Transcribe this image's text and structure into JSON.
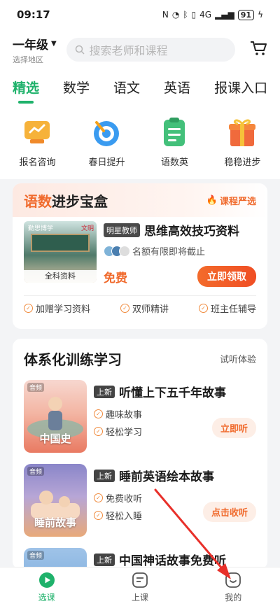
{
  "status": {
    "time": "09:17",
    "signal": "4G",
    "battery": "91"
  },
  "header": {
    "grade": "一年级",
    "region": "选择地区",
    "search_placeholder": "搜索老师和课程"
  },
  "tabs": [
    "精选",
    "数学",
    "语文",
    "英语",
    "报课入口"
  ],
  "quick": [
    {
      "label": "报名咨询",
      "color": "#f6b23a"
    },
    {
      "label": "春日提升",
      "color": "#3a9bf0"
    },
    {
      "label": "语数英",
      "color": "#43c07a"
    },
    {
      "label": "稳稳进步",
      "color": "#f06a3c"
    }
  ],
  "card1": {
    "title_hl": "语数",
    "title_rest": "进步宝盒",
    "strict": "课程严选",
    "thumb_tag": "勤思博学",
    "thumb_tag2": "文明",
    "thumb_caption": "全科资料",
    "teacher_badge": "明星教师",
    "name": "思维高效技巧资料",
    "quota": "名额有限即将截止",
    "price": "免费",
    "cta": "立即领取",
    "perks": [
      "加赠学习资料",
      "双师精讲",
      "班主任辅导"
    ]
  },
  "card2": {
    "title": "体系化训练学习",
    "trial": "试听体验",
    "courses": [
      {
        "new": "上新",
        "title": "听懂上下五千年故事",
        "tag": "音频",
        "thumb_label": "中国史",
        "features": [
          "趣味故事",
          "轻松学习"
        ],
        "cta": "立即听"
      },
      {
        "new": "上新",
        "title": "睡前英语绘本故事",
        "tag": "音频",
        "thumb_label": "睡前故事",
        "features": [
          "免费收听",
          "轻松入睡"
        ],
        "cta": "点击收听"
      },
      {
        "new": "上新",
        "title": "中国神话故事免费听",
        "tag": "音频",
        "thumb_label": "",
        "features": [],
        "cta": ""
      }
    ]
  },
  "tabbar": [
    {
      "label": "选课",
      "icon": "play-circle-icon"
    },
    {
      "label": "上课",
      "icon": "notes-icon"
    },
    {
      "label": "我的",
      "icon": "smile-face-icon"
    }
  ]
}
